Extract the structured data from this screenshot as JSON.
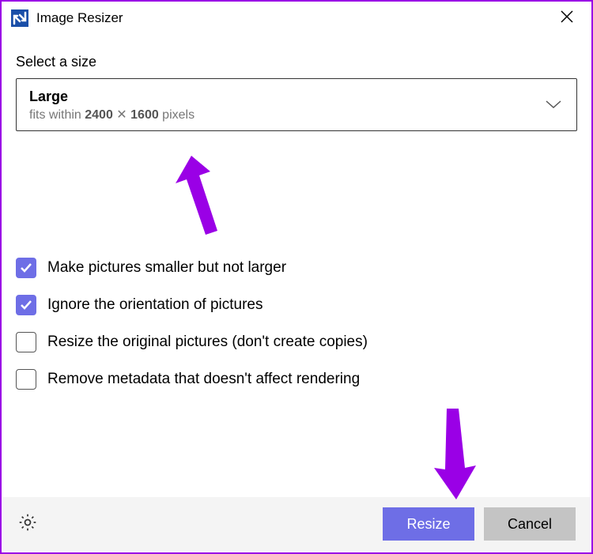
{
  "titlebar": {
    "title": "Image Resizer"
  },
  "section": {
    "label": "Select a size",
    "selected_name": "Large",
    "fits_prefix": "fits within ",
    "width": "2400",
    "times": " ✕ ",
    "height": "1600",
    "fits_suffix": " pixels"
  },
  "options": {
    "opt1": "Make pictures smaller but not larger",
    "opt2": "Ignore the orientation of pictures",
    "opt3": "Resize the original pictures (don't create copies)",
    "opt4": "Remove metadata that doesn't affect rendering"
  },
  "footer": {
    "resize": "Resize",
    "cancel": "Cancel"
  }
}
